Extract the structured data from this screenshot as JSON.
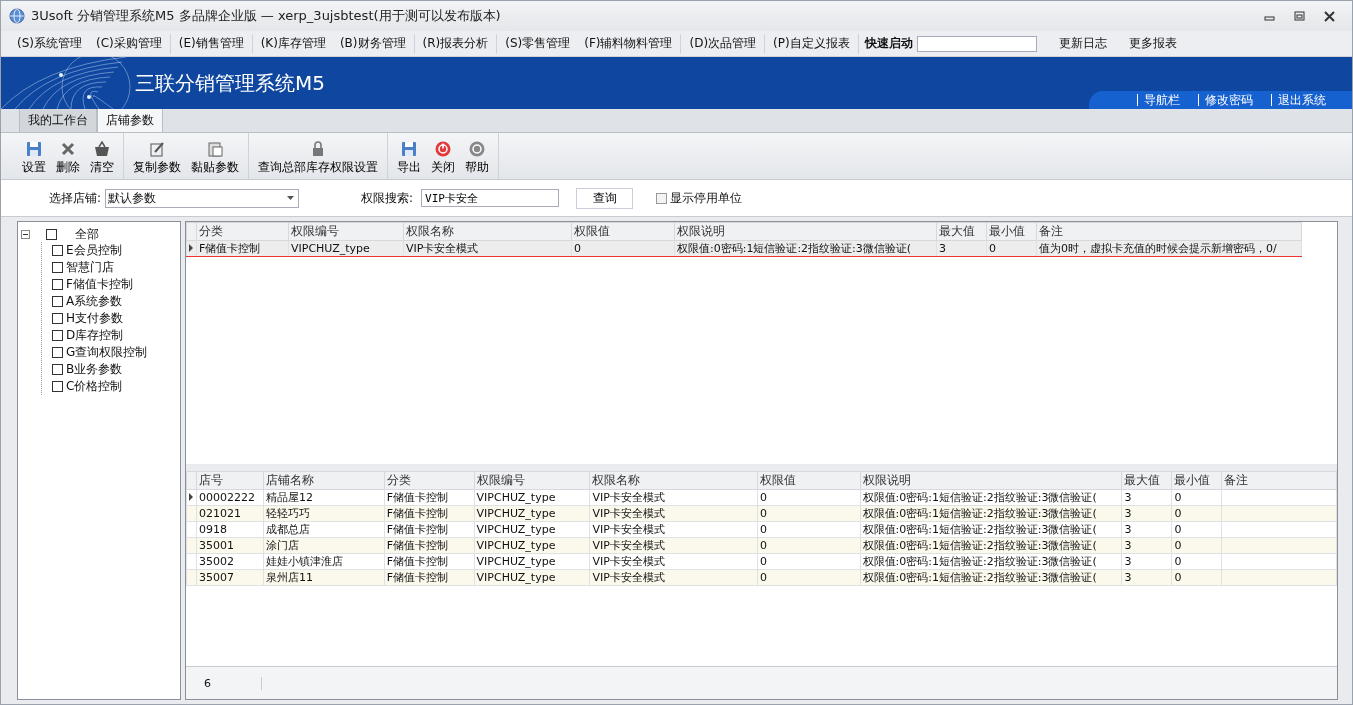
{
  "window": {
    "title": "3Usoft 分销管理系统M5 多品牌企业版 — xerp_3ujsbtest(用于测可以发布版本)"
  },
  "menu_groups": [
    [
      "(S)系统管理",
      "(C)采购管理"
    ],
    [
      "(E)销售管理"
    ],
    [
      "(K)库存管理",
      "(B)财务管理"
    ],
    [
      "(R)报表分析"
    ],
    [
      "(S)零售管理",
      "(F)辅料物料管理"
    ],
    [
      "(D)次品管理"
    ],
    [
      "(P)自定义报表"
    ]
  ],
  "quick_launch": {
    "label": "快速启动"
  },
  "menu_links": [
    "更新日志",
    "更多报表"
  ],
  "banner": {
    "title": "三联分销管理系统M5",
    "links": [
      "导航栏",
      "修改密码",
      "退出系统"
    ]
  },
  "tabs": [
    {
      "label": "我的工作台",
      "selected": false
    },
    {
      "label": "店铺参数",
      "selected": true
    }
  ],
  "toolbar_groups": [
    [
      {
        "label": "设置"
      },
      {
        "label": "删除"
      },
      {
        "label": "清空"
      }
    ],
    [
      {
        "label": "复制参数"
      },
      {
        "label": "黏贴参数"
      }
    ],
    [
      {
        "label": "查询总部库存权限设置"
      }
    ],
    [
      {
        "label": "导出"
      },
      {
        "label": "关闭"
      },
      {
        "label": "帮助"
      }
    ]
  ],
  "filter": {
    "store_label": "选择店铺:",
    "store_value": "默认参数",
    "search_label": "权限搜索:",
    "search_value": "VIP卡安全",
    "query_button": "查询",
    "show_disabled": {
      "label": "显示停用单位",
      "checked": false
    }
  },
  "tree": {
    "label": "全部",
    "expanded": true,
    "checked": false,
    "children": [
      {
        "label": "E会员控制",
        "checked": false
      },
      {
        "label": "智慧门店",
        "checked": false
      },
      {
        "label": "F储值卡控制",
        "checked": false
      },
      {
        "label": "A系统参数",
        "checked": false
      },
      {
        "label": "H支付参数",
        "checked": false
      },
      {
        "label": "D库存控制",
        "checked": false
      },
      {
        "label": "G查询权限控制",
        "checked": false
      },
      {
        "label": "B业务参数",
        "checked": false
      },
      {
        "label": "C价格控制",
        "checked": false
      }
    ]
  },
  "upper_table": {
    "columns": [
      "分类",
      "权限编号",
      "权限名称",
      "权限值",
      "权限说明",
      "最大值",
      "最小值",
      "备注"
    ],
    "rows": [
      {
        "selected": true,
        "cells": [
          "F储值卡控制",
          "VIPCHUZ_type",
          "VIP卡安全模式",
          "0",
          "权限值:0密码:1短信验证:2指纹验证:3微信验证(",
          "3",
          "0",
          "值为0时，虚拟卡充值的时候会提示新增密码，0/"
        ]
      }
    ]
  },
  "lower_table": {
    "columns": [
      "店号",
      "店铺名称",
      "分类",
      "权限编号",
      "权限名称",
      "权限值",
      "权限说明",
      "最大值",
      "最小值",
      "备注"
    ],
    "rows": [
      {
        "selected": true,
        "cells": [
          "00002222",
          "精品屋12",
          "F储值卡控制",
          "VIPCHUZ_type",
          "VIP卡安全模式",
          "0",
          "权限值:0密码:1短信验证:2指纹验证:3微信验证(",
          "3",
          "0"
        ]
      },
      {
        "selected": false,
        "cells": [
          "021021",
          "轻轻巧巧",
          "F储值卡控制",
          "VIPCHUZ_type",
          "VIP卡安全模式",
          "0",
          "权限值:0密码:1短信验证:2指纹验证:3微信验证(",
          "3",
          "0"
        ]
      },
      {
        "selected": false,
        "cells": [
          "0918",
          "成都总店",
          "F储值卡控制",
          "VIPCHUZ_type",
          "VIP卡安全模式",
          "0",
          "权限值:0密码:1短信验证:2指纹验证:3微信验证(",
          "3",
          "0"
        ]
      },
      {
        "selected": false,
        "cells": [
          "35001",
          "涂门店",
          "F储值卡控制",
          "VIPCHUZ_type",
          "VIP卡安全模式",
          "0",
          "权限值:0密码:1短信验证:2指纹验证:3微信验证(",
          "3",
          "0"
        ]
      },
      {
        "selected": false,
        "cells": [
          "35002",
          "娃娃小镇津淮店",
          "F储值卡控制",
          "VIPCHUZ_type",
          "VIP卡安全模式",
          "0",
          "权限值:0密码:1短信验证:2指纹验证:3微信验证(",
          "3",
          "0"
        ]
      },
      {
        "selected": false,
        "cells": [
          "35007",
          "泉州店11",
          "F储值卡控制",
          "VIPCHUZ_type",
          "VIP卡安全模式",
          "0",
          "权限值:0密码:1短信验证:2指纹验证:3微信验证(",
          "3",
          "0"
        ]
      }
    ]
  },
  "status_bar": {
    "count": "6"
  }
}
